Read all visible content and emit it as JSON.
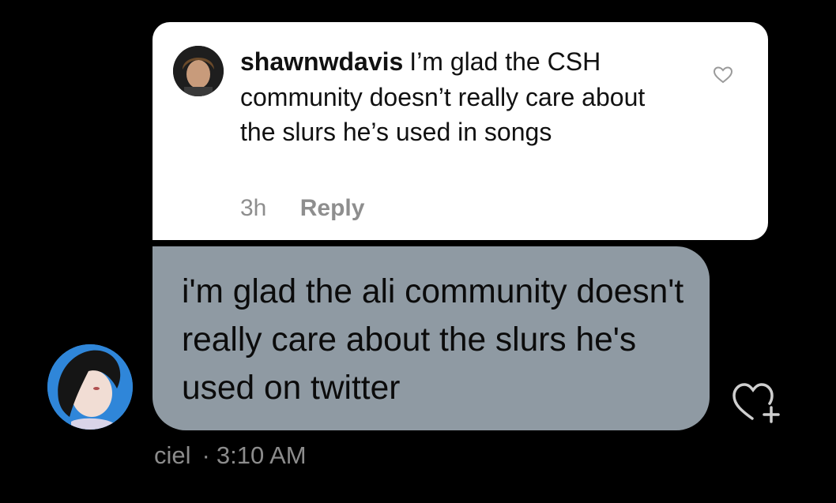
{
  "quoted_comment": {
    "username": "shawnwdavis",
    "text": "I’m glad the CSH community doesn’t really care about the slurs he’s used in songs",
    "time": "3h",
    "reply_label": "Reply",
    "like_icon": "heart-outline-icon"
  },
  "reply_message": {
    "text": "i'm glad the ali community doesn't really care about the slurs he's used on twitter",
    "bubble_color": "#8f9aa3",
    "react_icon": "heart-plus-icon"
  },
  "footer": {
    "sender": "ciel",
    "separator": "·",
    "timestamp": "3:10 AM"
  },
  "colors": {
    "background": "#000000",
    "card": "#ffffff",
    "muted_text": "#8e8e8e"
  }
}
